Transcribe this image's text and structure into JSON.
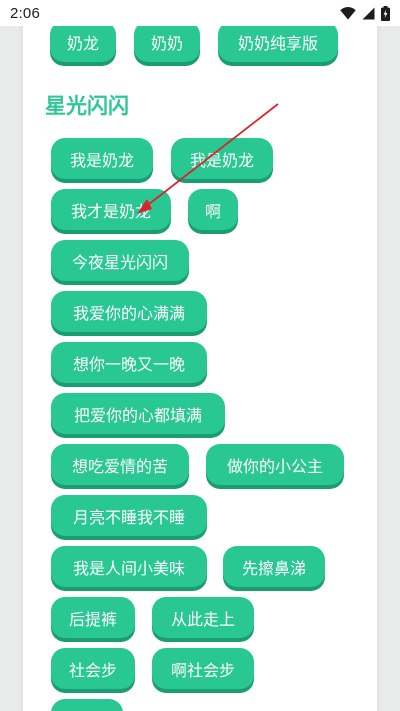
{
  "status_bar": {
    "time": "2:06"
  },
  "top_row": [
    {
      "label": "奶龙"
    },
    {
      "label": "奶奶"
    },
    {
      "label": "奶奶纯享版"
    }
  ],
  "section": {
    "title": "星光闪闪",
    "buttons": [
      {
        "label": "我是奶龙"
      },
      {
        "label": "我是奶龙"
      },
      {
        "label": "我才是奶龙"
      },
      {
        "label": "啊"
      },
      {
        "label": "今夜星光闪闪"
      },
      {
        "label": "我爱你的心满满"
      },
      {
        "label": "想你一晚又一晚"
      },
      {
        "label": "把爱你的心都填满"
      },
      {
        "label": "想吃爱情的苦"
      },
      {
        "label": "做你的小公主"
      },
      {
        "label": "月亮不睡我不睡"
      },
      {
        "label": "我是人间小美味"
      },
      {
        "label": "先擦鼻涕"
      },
      {
        "label": "后提裤"
      },
      {
        "label": "从此走上"
      },
      {
        "label": "社会步"
      },
      {
        "label": "啊社会步"
      },
      {
        "label": ""
      }
    ]
  },
  "colors": {
    "accent": "#29c792",
    "accent_shadow": "#1a9e70",
    "title": "#2fc796",
    "annotation_arrow": "#d9262c"
  }
}
